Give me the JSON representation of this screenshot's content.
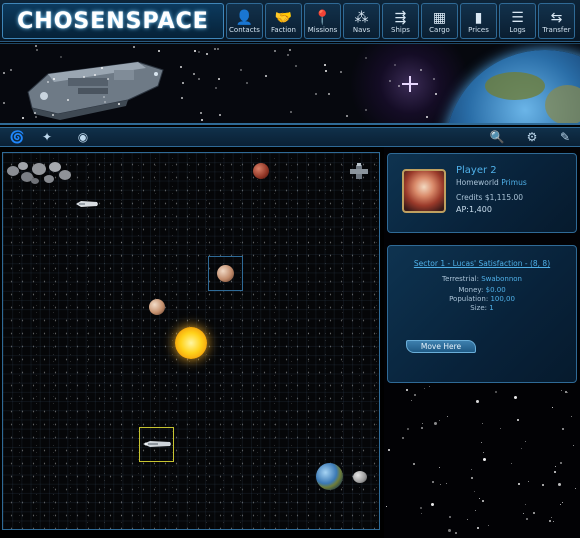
{
  "logo": {
    "text": "CHOSENSPACE"
  },
  "nav": [
    {
      "label": "Contacts",
      "icon": "contacts-icon",
      "glyph": "👤"
    },
    {
      "label": "Faction",
      "icon": "handshake-icon",
      "glyph": "🤝"
    },
    {
      "label": "Missions",
      "icon": "map-pin-icon",
      "glyph": "📍"
    },
    {
      "label": "Navs",
      "icon": "nav-points-icon",
      "glyph": "⁂"
    },
    {
      "label": "Ships",
      "icon": "ships-icon",
      "glyph": "⇶"
    },
    {
      "label": "Cargo",
      "icon": "cargo-icon",
      "glyph": "▦"
    },
    {
      "label": "Prices",
      "icon": "bar-chart-icon",
      "glyph": "▮"
    },
    {
      "label": "Logs",
      "icon": "log-list-icon",
      "glyph": "☰"
    },
    {
      "label": "Transfer",
      "icon": "transfer-arrows-icon",
      "glyph": "⇆"
    }
  ],
  "toolbar": {
    "left": [
      {
        "name": "galaxy-icon",
        "glyph": "🌀"
      },
      {
        "name": "sparkles-icon",
        "glyph": "✦"
      },
      {
        "name": "eye-icon",
        "glyph": "◉"
      }
    ],
    "right": [
      {
        "name": "search-icon",
        "glyph": "🔍"
      },
      {
        "name": "gear-icon",
        "glyph": "⚙"
      },
      {
        "name": "pencil-icon",
        "glyph": "✎"
      }
    ]
  },
  "player": {
    "name": "Player 2",
    "homeworld_label": "Homeworld",
    "homeworld_value": "Primus",
    "credits_label": "Credits",
    "credits_value": "$1,115.00",
    "ap_label": "AP",
    "ap_value": "1,400"
  },
  "sector": {
    "title": "Sector 1 - Lucas' Satisfaction - (8, 8)",
    "type_label": "Terrestrial",
    "type_value": "Swabonnon",
    "money_label": "Money",
    "money_value": "$0.00",
    "population_label": "Population",
    "population_value": "100,00",
    "size_label": "Size",
    "size_value": "1",
    "move_label": "Move Here"
  },
  "colors": {
    "accent": "#4fb0e8",
    "border": "#2f6a96",
    "panel": "#08223a"
  }
}
